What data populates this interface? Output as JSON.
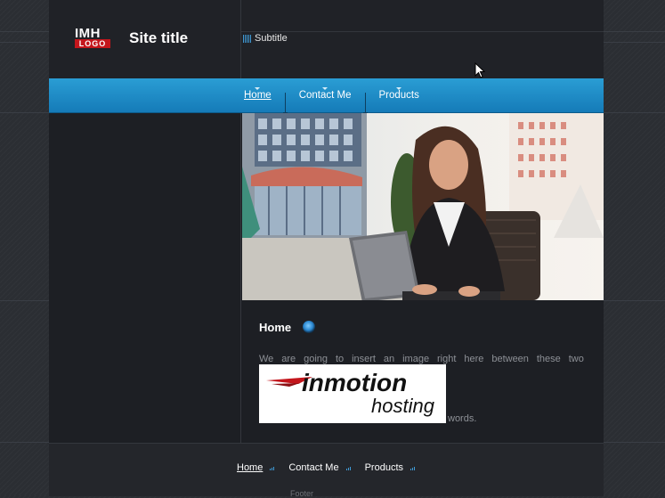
{
  "header": {
    "logo_line1": "IMH",
    "logo_line2": "LOGO",
    "site_title": "Site title",
    "subtitle": "Subtitle"
  },
  "nav": {
    "items": [
      {
        "label": "Home",
        "active": true
      },
      {
        "label": "Contact Me",
        "active": false
      },
      {
        "label": "Products",
        "active": false
      }
    ]
  },
  "hero": {
    "icon": "woman-at-laptop-photo"
  },
  "content": {
    "title": "Home",
    "paragraph_words": [
      "We",
      "are",
      "going",
      "to",
      "insert",
      "an",
      "image",
      "right",
      "here",
      "between",
      "these",
      "two"
    ],
    "after_image": "words.",
    "image_text_1": "inmotion",
    "image_text_2": "hosting"
  },
  "footer": {
    "items": [
      {
        "label": "Home",
        "active": true
      },
      {
        "label": "Contact Me",
        "active": false
      },
      {
        "label": "Products",
        "active": false
      }
    ],
    "text": "Footer"
  },
  "colors": {
    "accent": "#2a9dd4",
    "background": "#1d1f24"
  }
}
